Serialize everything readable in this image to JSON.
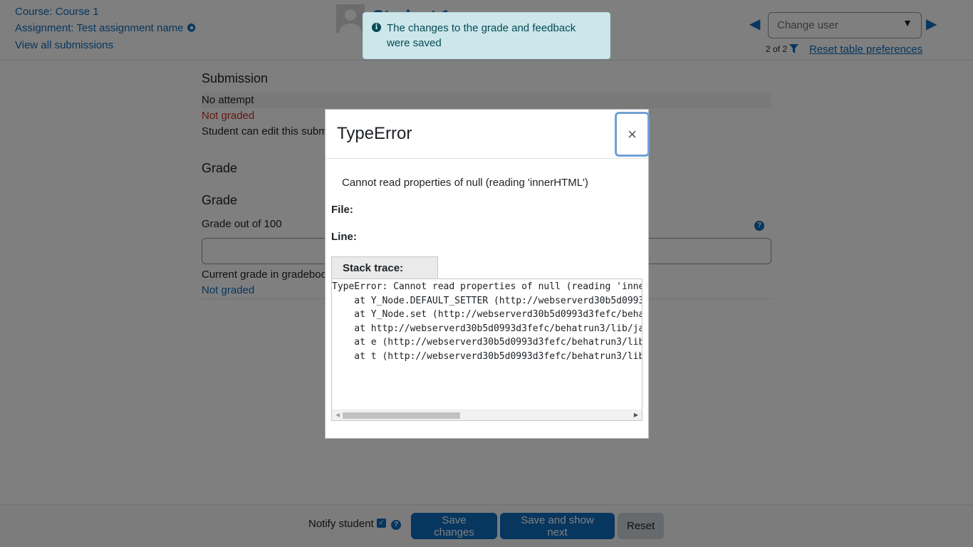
{
  "header": {
    "course_link": "Course: Course 1",
    "assignment_link": "Assignment: Test assignment name",
    "view_all": "View all submissions",
    "student_name": "Student 1",
    "change_user_placeholder": "Change user",
    "pager": "2 of 2",
    "reset_prefs": "Reset table preferences"
  },
  "main": {
    "submission_heading": "Submission",
    "attempt_status": "No attempt",
    "grading_status": "Not graded",
    "edit_status": "Student can edit this submission",
    "grade_heading_1": "Grade",
    "grade_heading_2": "Grade",
    "grade_out_of": "Grade out of 100",
    "current_grade_label": "Current grade in gradebook",
    "current_grade_value": "Not graded"
  },
  "footer": {
    "notify_label": "Notify student",
    "save_changes": "Save changes",
    "save_show_next": "Save and show next",
    "reset": "Reset"
  },
  "toast": {
    "message": "The changes to the grade and feedback were saved"
  },
  "modal": {
    "title": "TypeError",
    "close_glyph": "×",
    "message": "Cannot read properties of null (reading 'innerHTML')",
    "file_label": "File:",
    "line_label": "Line:",
    "stack_tab": "Stack trace:",
    "stack_trace": "TypeError: Cannot read properties of null (reading 'innerHTML')\n    at Y_Node.DEFAULT_SETTER (http://webserverd30b5d0993d3fefc/behatrun3/lib/yui/\n    at Y_Node.set (http://webserverd30b5d0993d3fefc/behatrun3/lib/yui/\n    at http://webserverd30b5d0993d3fefc/behatrun3/lib/javascript.php\n    at e (http://webserverd30b5d0993d3fefc/behatrun3/lib/javascript.php\n    at t (http://webserverd30b5d0993d3fefc/behatrun3/lib/javascript.php"
  },
  "icons": {
    "gear": "gear-icon",
    "filter": "filter-icon",
    "info": "info-icon",
    "help": "help-icon",
    "prev": "left-arrow-icon",
    "next": "right-arrow-icon"
  },
  "colors": {
    "accent": "#0f6cbf",
    "danger": "#ca3120",
    "toast_bg": "#cce6ea"
  }
}
